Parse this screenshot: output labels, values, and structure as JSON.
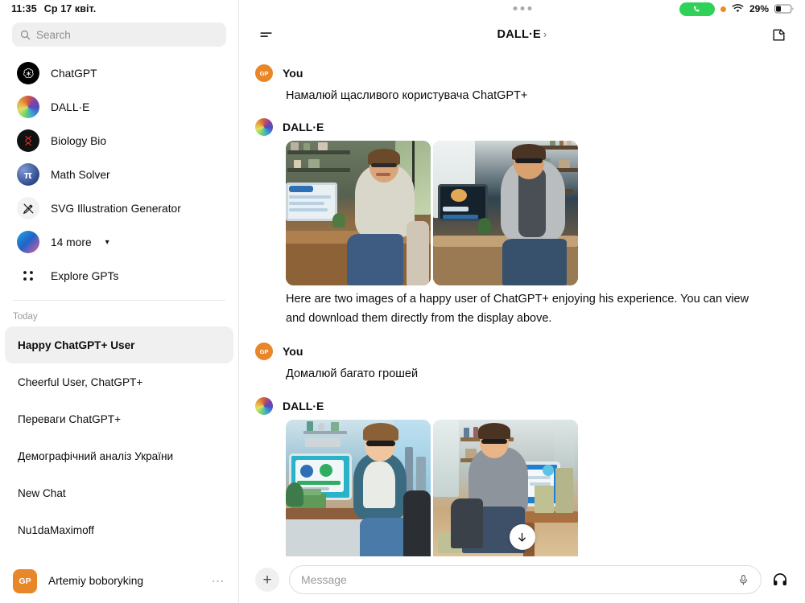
{
  "status_bar": {
    "time": "11:35",
    "date": "Ср 17 квіт.",
    "call_icon": "phone-icon",
    "recording_dot": "recording-indicator",
    "wifi_icon": "wifi-icon",
    "battery_percent": "29%",
    "battery_icon": "battery-icon",
    "multitask_handle": "multitasking-handle"
  },
  "sidebar": {
    "search": {
      "placeholder": "Search",
      "icon": "search-icon"
    },
    "gpts": [
      {
        "label": "ChatGPT",
        "icon": "chatgpt-logo-avatar"
      },
      {
        "label": "DALL·E",
        "icon": "dalle-color-wheel-avatar"
      },
      {
        "label": "Biology Bio",
        "icon": "biology-dna-avatar"
      },
      {
        "label": "Math Solver",
        "icon": "math-pi-avatar"
      },
      {
        "label": "SVG Illustration Generator",
        "icon": "svg-pen-avatar"
      },
      {
        "label": "14 more",
        "icon": "stacked-avatars",
        "chevron": "chevron-down-icon"
      }
    ],
    "explore": {
      "label": "Explore GPTs",
      "icon": "grid-icon"
    },
    "section_label": "Today",
    "chats": [
      {
        "title": "Happy ChatGPT+ User",
        "active": true
      },
      {
        "title": "Cheerful User, ChatGPT+",
        "active": false
      },
      {
        "title": "Переваги ChatGPT+",
        "active": false
      },
      {
        "title": "Демографічний аналіз України",
        "active": false
      },
      {
        "title": "New Chat",
        "active": false
      },
      {
        "title": "Nu1daMaximoff",
        "active": false
      }
    ],
    "profile": {
      "name": "Artemiy boboryking",
      "initials": "GP",
      "more_icon": "ellipsis-icon"
    }
  },
  "header": {
    "sidebar_toggle_icon": "sidebar-toggle-icon",
    "title": "DALL·E",
    "title_arrow": "›",
    "compose_icon": "compose-icon"
  },
  "thread": {
    "messages": [
      {
        "author": "You",
        "avatar": "user-avatar",
        "initials": "GP",
        "text": "Намалюй щасливого користувача ChatGPT+",
        "images": []
      },
      {
        "author": "DALL·E",
        "avatar": "dalle-avatar",
        "text": "Here are two images of a happy user of ChatGPT+ enjoying his experience. You can view and download them directly from the display above.",
        "images": [
          {
            "alt": "photoreal smiling man at desk with ChatGPT monitor and bookshelves"
          },
          {
            "alt": "photoreal smiling man at desk with dark monitor showing cat logo ChatPT+"
          }
        ]
      },
      {
        "author": "You",
        "avatar": "user-avatar",
        "initials": "GP",
        "text": "Домалюй багато грошей",
        "images": []
      },
      {
        "author": "DALL·E",
        "avatar": "dalle-avatar",
        "text": "",
        "images": [
          {
            "alt": "cartoon man at desk with stacks of money and teal monitor, city skyline"
          },
          {
            "alt": "3D render man at desk with blue monitor and tall stacks of money"
          }
        ]
      }
    ],
    "scroll_button_icon": "arrow-down-icon"
  },
  "composer": {
    "add_icon": "plus-icon",
    "placeholder": "Message",
    "mic_icon": "microphone-icon",
    "headset_icon": "headphones-icon"
  },
  "colors": {
    "accent_orange": "#e8872a",
    "call_green": "#30d158",
    "record_orange": "#f08c1b",
    "active_chat_bg": "#f0f0f0"
  }
}
